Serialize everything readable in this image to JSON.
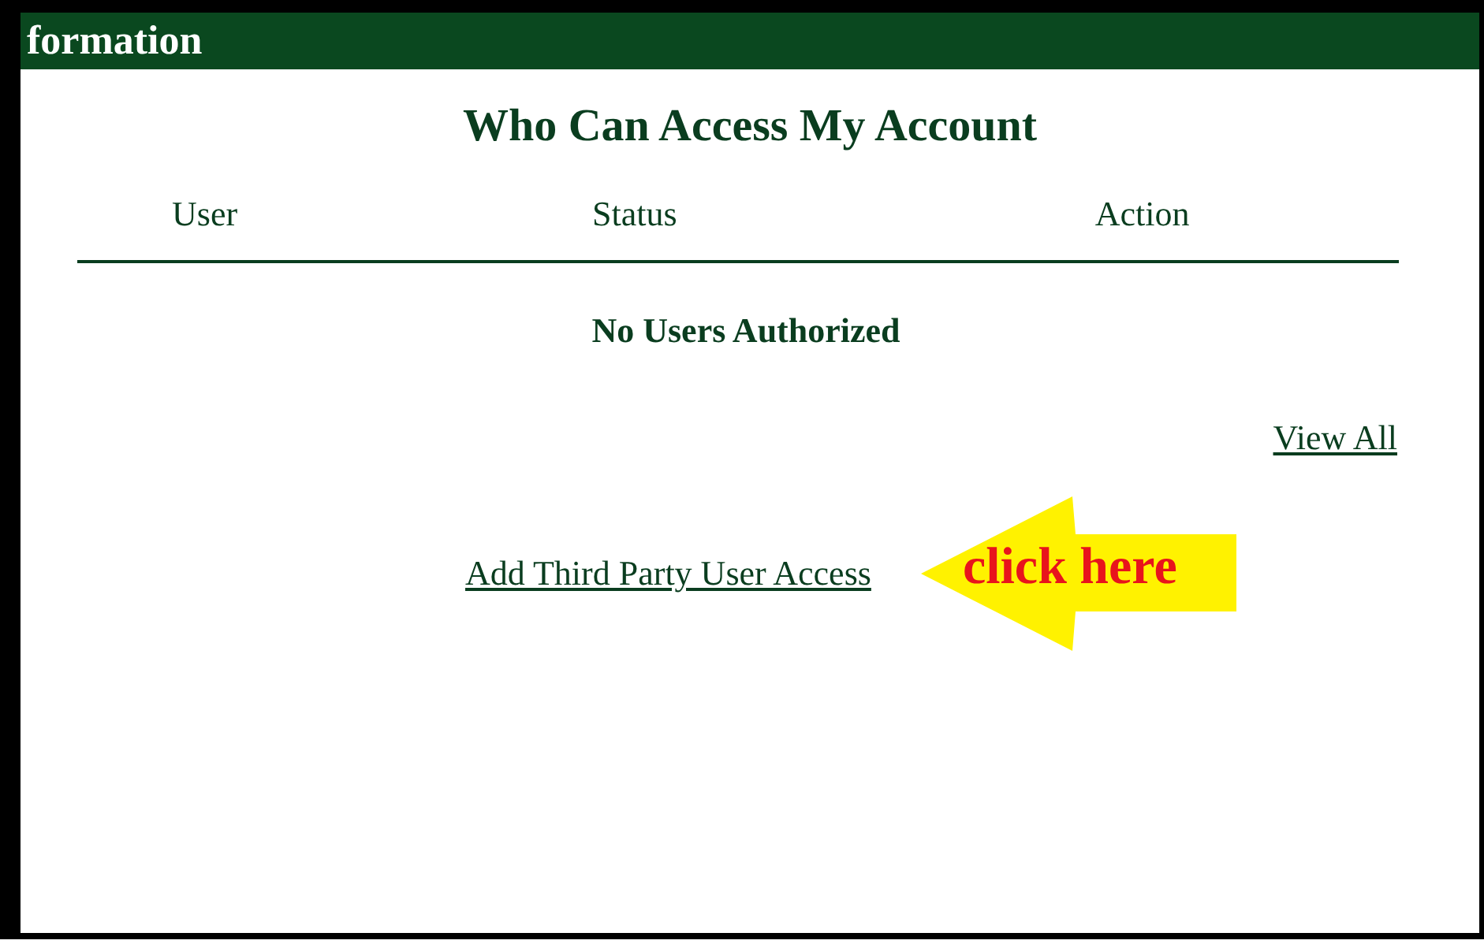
{
  "header": {
    "title": "formation"
  },
  "section": {
    "title": "Who Can Access My Account"
  },
  "table": {
    "columns": [
      "User",
      "Status",
      "Action"
    ],
    "empty_message": "No Users Authorized"
  },
  "links": {
    "view_all": "View All",
    "add_access": "Add Third Party User Access"
  },
  "callout": {
    "text": "click here"
  }
}
